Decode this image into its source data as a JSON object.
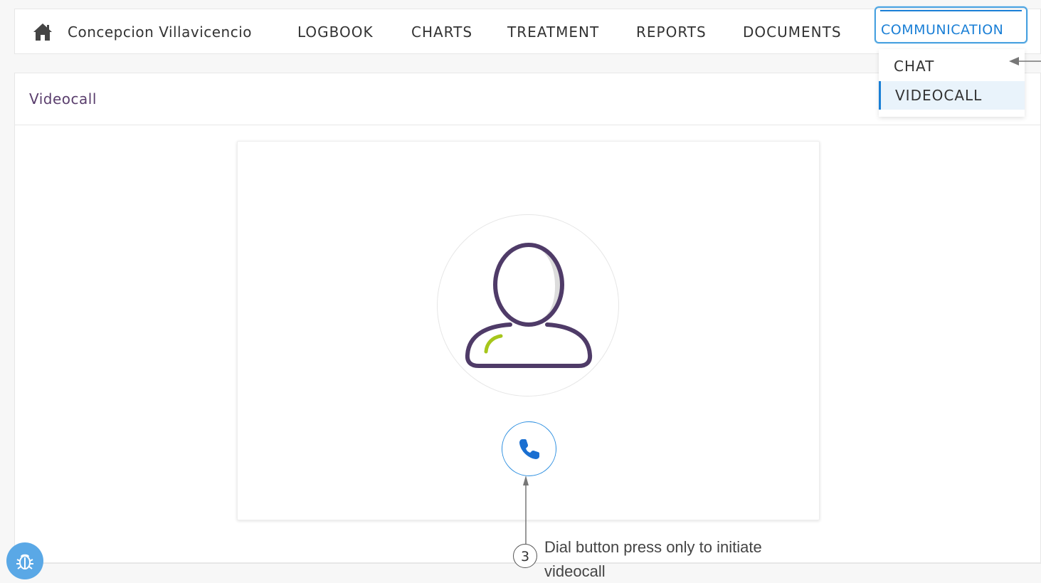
{
  "navbar": {
    "home_icon": "home-icon",
    "patient_name": "Concepcion Villavicencio",
    "items": [
      {
        "label": "LOGBOOK"
      },
      {
        "label": "CHARTS"
      },
      {
        "label": "TREATMENT"
      },
      {
        "label": "REPORTS"
      },
      {
        "label": "DOCUMENTS"
      },
      {
        "label": "COMMUNICATION",
        "active": true
      }
    ]
  },
  "dropdown": {
    "items": [
      {
        "label": "CHAT"
      },
      {
        "label": "VIDEOCALL",
        "selected": true
      }
    ]
  },
  "panel": {
    "title": "Videocall"
  },
  "call_card": {
    "avatar_icon": "user-placeholder-icon",
    "dial_icon": "phone-icon"
  },
  "annotation": {
    "number": "3",
    "text_line1": "Dial button press only to initiate",
    "text_line2": "videocall"
  },
  "colors": {
    "accent": "#1a7fd6",
    "avatar_outline": "#4f3b68",
    "avatar_highlight": "#a6c61b",
    "title": "#5a3e6d"
  },
  "debug_icon": "bug-icon"
}
